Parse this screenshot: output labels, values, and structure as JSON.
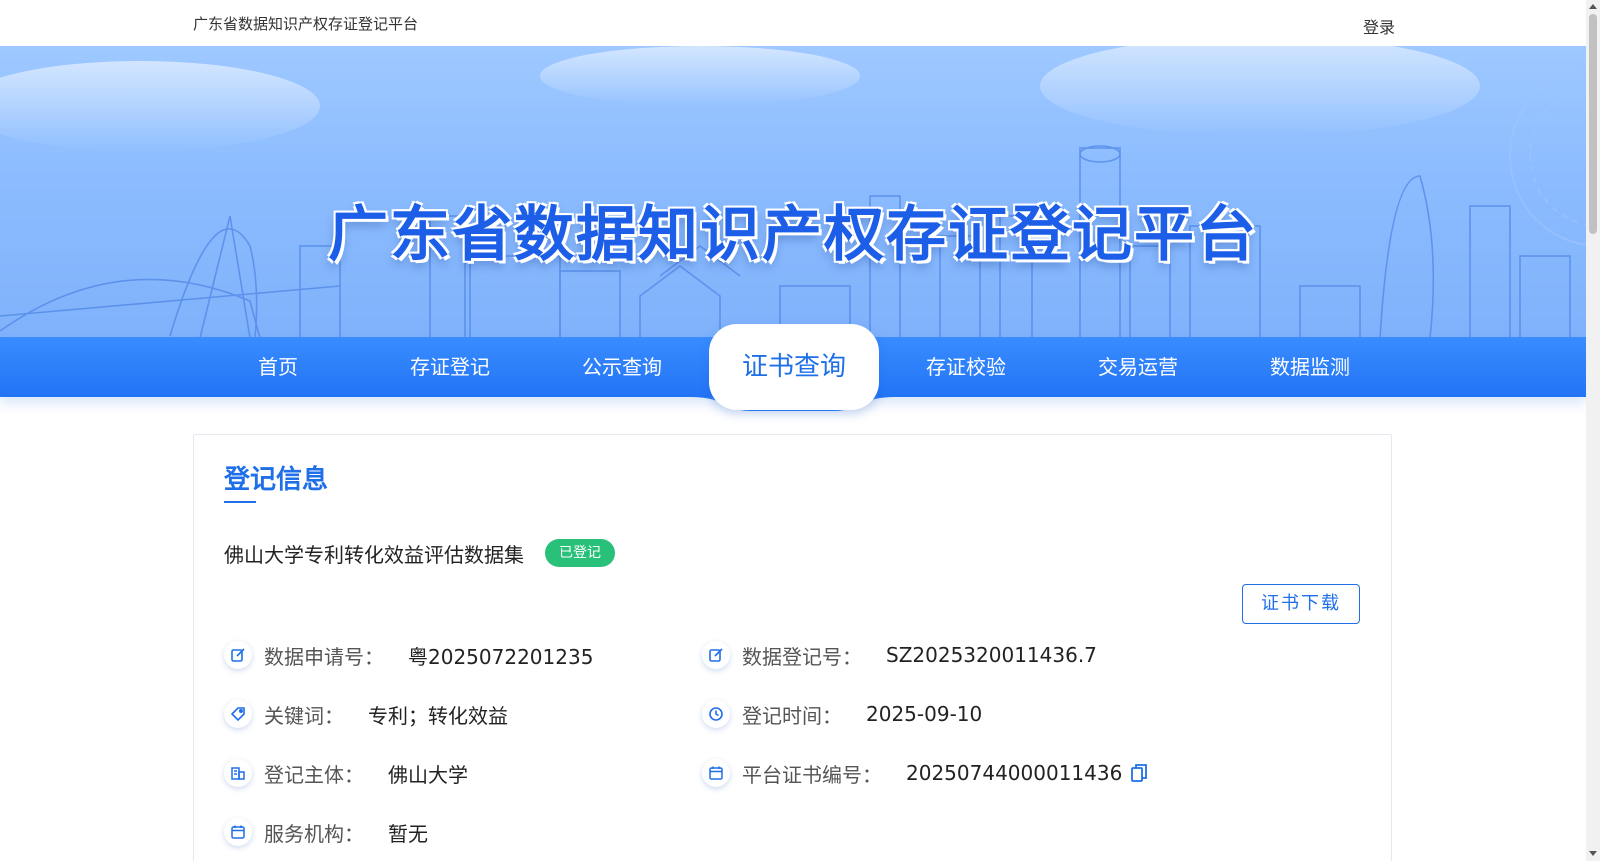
{
  "topbar": {
    "site_name": "广东省数据知识产权存证登记平台",
    "login": "登录"
  },
  "banner": {
    "title": "广东省数据知识产权存证登记平台"
  },
  "nav": {
    "items": [
      {
        "label": "首页"
      },
      {
        "label": "存证登记"
      },
      {
        "label": "公示查询"
      },
      {
        "label": "证书查询",
        "active": true
      },
      {
        "label": "存证校验"
      },
      {
        "label": "交易运营"
      },
      {
        "label": "数据监测"
      }
    ]
  },
  "registration": {
    "section_title": "登记信息",
    "dataset_name": "佛山大学专利转化效益评估数据集",
    "status": "已登记",
    "download_label": "证书下载",
    "fields": {
      "application_no_label": "数据申请号：",
      "application_no": "粤2025072201235",
      "registration_no_label": "数据登记号：",
      "registration_no": "SZ2025320011436.7",
      "keywords_label": "关键词：",
      "keywords": "专利；转化效益",
      "registration_time_label": "登记时间：",
      "registration_time": "2025-09-10",
      "subject_label": "登记主体：",
      "subject": "佛山大学",
      "cert_no_label": "平台证书编号：",
      "cert_no": "20250744000011436",
      "service_org_label": "服务机构：",
      "service_org": "暂无"
    }
  },
  "colors": {
    "primary": "#1f6fe8",
    "nav_bg": "#2a7ff8",
    "status_green": "#29c07a"
  },
  "icons": {
    "application_no": "edit-icon",
    "registration_no": "edit-icon",
    "keywords": "tag-icon",
    "registration_time": "clock-icon",
    "subject": "building-icon",
    "cert_no": "calendar-icon",
    "service_org": "calendar-icon",
    "copy": "copy-icon"
  }
}
